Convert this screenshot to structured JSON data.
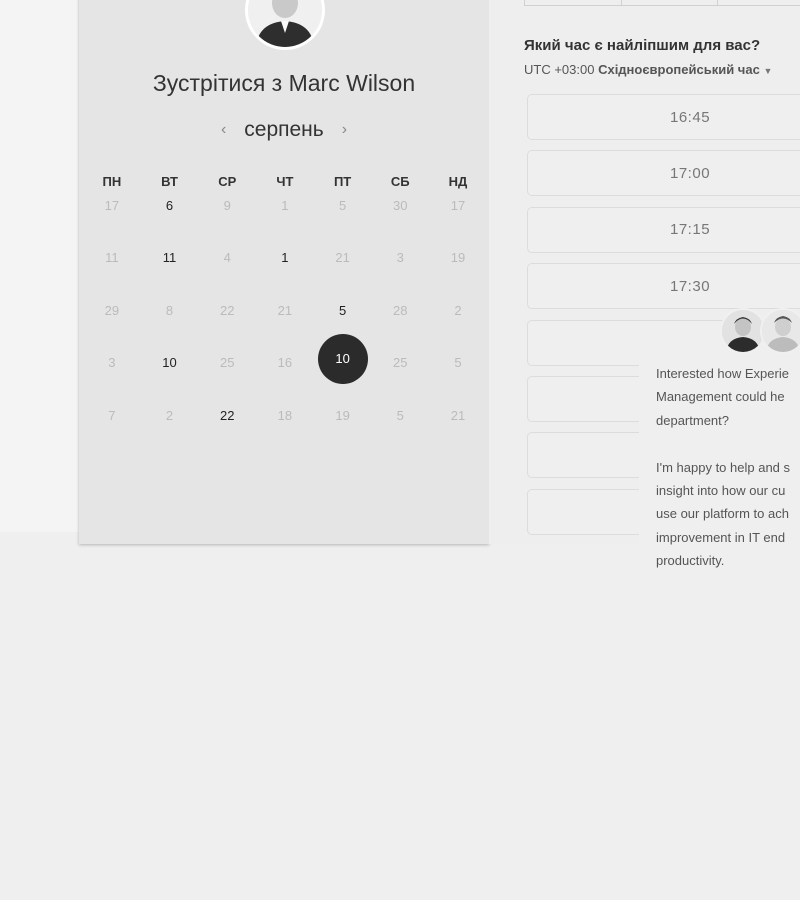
{
  "meeting": {
    "title": "Зустрітися з Marc Wilson",
    "month": "серпень",
    "prev_icon": "chevron-left-icon",
    "next_icon": "chevron-right-icon"
  },
  "calendar": {
    "weekdays": [
      "ПН",
      "ВТ",
      "СР",
      "ЧТ",
      "ПТ",
      "СБ",
      "НД"
    ],
    "days": [
      {
        "label": "17",
        "active": false
      },
      {
        "label": "6",
        "active": true
      },
      {
        "label": "9",
        "active": false
      },
      {
        "label": "1",
        "active": false
      },
      {
        "label": "5",
        "active": false
      },
      {
        "label": "30",
        "active": false
      },
      {
        "label": "17",
        "active": false
      },
      {
        "label": "11",
        "active": false
      },
      {
        "label": "11",
        "active": true
      },
      {
        "label": "4",
        "active": false
      },
      {
        "label": "1",
        "active": true
      },
      {
        "label": "21",
        "active": false
      },
      {
        "label": "3",
        "active": false
      },
      {
        "label": "19",
        "active": false
      },
      {
        "label": "29",
        "active": false
      },
      {
        "label": "8",
        "active": false
      },
      {
        "label": "22",
        "active": false
      },
      {
        "label": "21",
        "active": false
      },
      {
        "label": "5",
        "active": true
      },
      {
        "label": "28",
        "active": false
      },
      {
        "label": "2",
        "active": false
      },
      {
        "label": "3",
        "active": false
      },
      {
        "label": "10",
        "active": true
      },
      {
        "label": "25",
        "active": false
      },
      {
        "label": "16",
        "active": false
      },
      {
        "label": "10",
        "active": true,
        "selected": true
      },
      {
        "label": "25",
        "active": false
      },
      {
        "label": "5",
        "active": false
      },
      {
        "label": "7",
        "active": false
      },
      {
        "label": "2",
        "active": false
      },
      {
        "label": "22",
        "active": true
      },
      {
        "label": "18",
        "active": false
      },
      {
        "label": "19",
        "active": false
      },
      {
        "label": "5",
        "active": false
      },
      {
        "label": "21",
        "active": false
      }
    ]
  },
  "times": {
    "question": "Який час є найліпшим для вас?",
    "timezone_offset": "UTC +03:00",
    "timezone_name": "Східноєвропейський час",
    "slots": [
      "16:45",
      "17:00",
      "17:15",
      "17:30",
      "",
      "",
      "",
      ""
    ]
  },
  "chat": {
    "lines": [
      "Interested how Experie",
      "Management could he",
      "department?",
      "",
      "I'm happy to help and s",
      "insight into how our cu",
      "use our platform to ach",
      "improvement in IT end",
      "productivity."
    ]
  },
  "colors": {
    "selected_day": "#2b2b2b",
    "card_bg": "#e5e5e5",
    "page_bg": "#efefef"
  }
}
